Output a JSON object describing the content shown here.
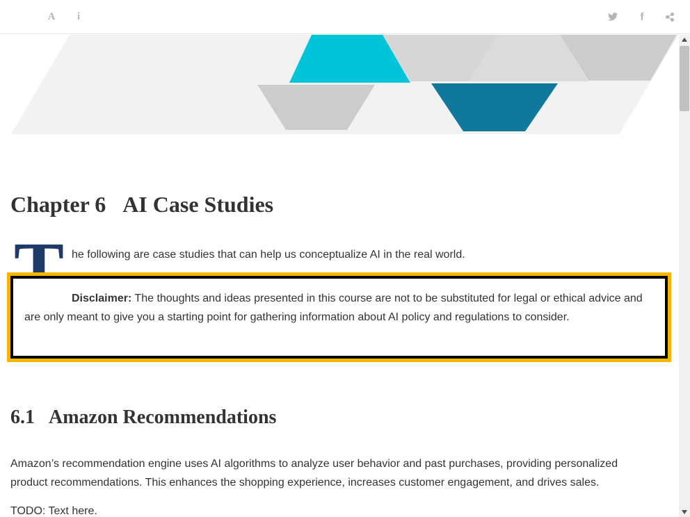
{
  "toolbar": {
    "font_icon": "A",
    "info_icon": "i",
    "facebook_icon": "f"
  },
  "banner": {
    "colors": {
      "teal_light": "#00c5d9",
      "teal_dark": "#10789a",
      "gray": "#cccccc",
      "light_gray": "#f2f2f2"
    }
  },
  "chapter": {
    "number": "Chapter 6",
    "title": "AI Case Studies"
  },
  "intro": {
    "dropcap": "T",
    "text": "he following are case studies that can help us conceptualize AI in the real world."
  },
  "disclaimer": {
    "label": "Disclaimer:",
    "text": " The thoughts and ideas presented in this course are not to be substituted for legal or ethical advice and are only meant to give you a starting point for gathering information about AI policy and regulations to consider.",
    "border_color": "#000000",
    "outline_color": "#f7b500"
  },
  "section": {
    "number": "6.1",
    "title": "Amazon Recommendations",
    "paragraph": "Amazon’s recommendation engine uses AI algorithms to analyze user behavior and past purchases, providing personalized product recommendations. This enhances the shopping experience, increases customer engagement, and drives sales.",
    "todo": "TODO: Text here."
  },
  "colors": {
    "dropcap": "#1f3a68"
  }
}
